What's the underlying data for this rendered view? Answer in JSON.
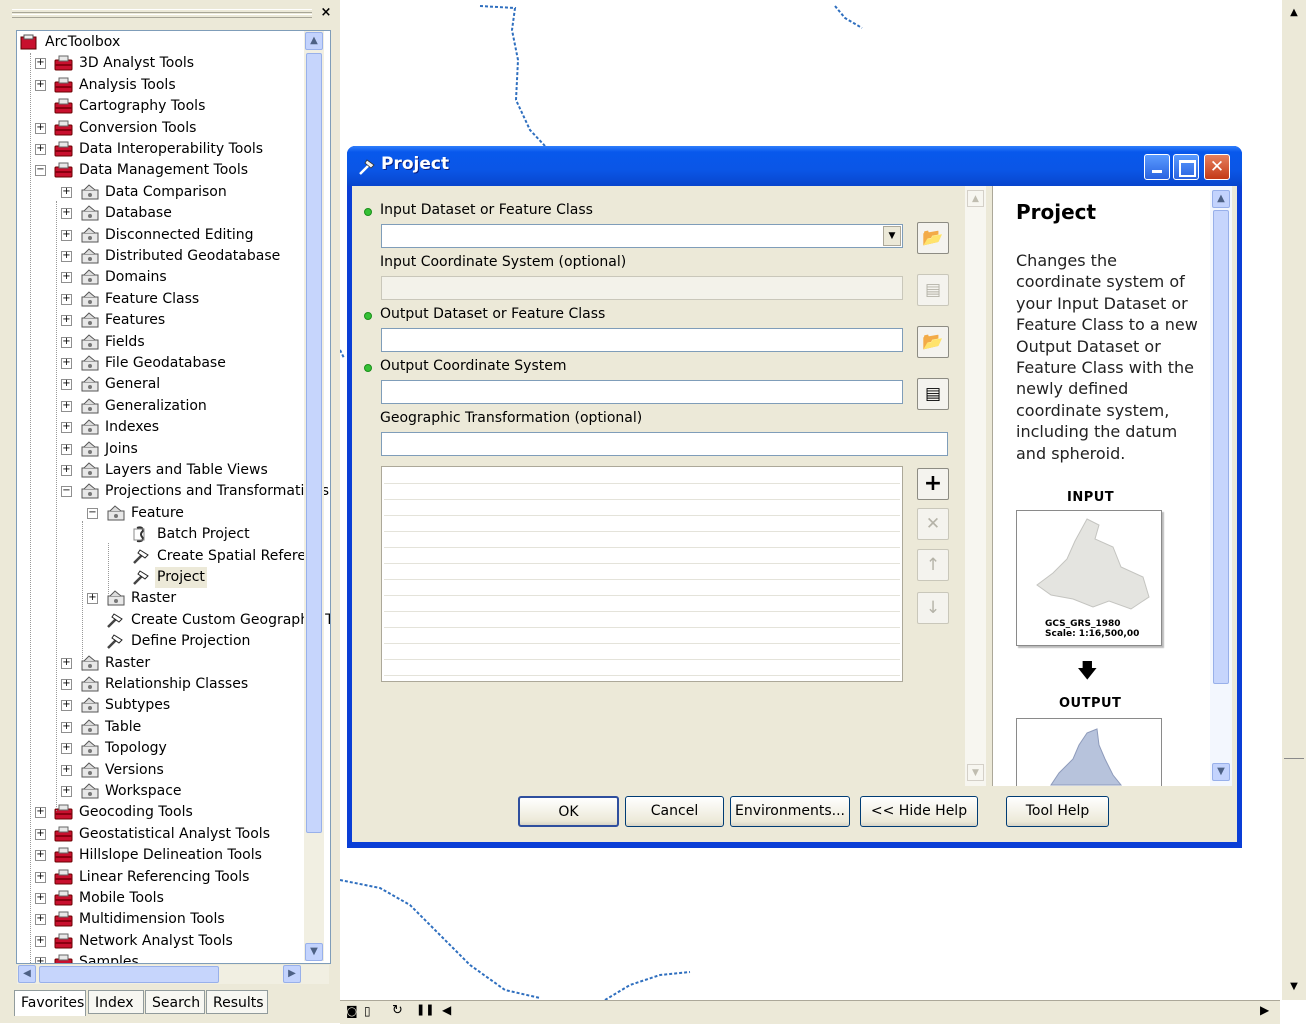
{
  "toolbox": {
    "close_label": "×",
    "tree": [
      {
        "label": "ArcToolbox",
        "level": 0,
        "expander": "",
        "icon": "arctoolbox-icon"
      },
      {
        "label": "3D Analyst Tools",
        "level": 1,
        "expander": "+",
        "icon": "toolbox-icon"
      },
      {
        "label": "Analysis Tools",
        "level": 1,
        "expander": "+",
        "icon": "toolbox-icon"
      },
      {
        "label": "Cartography Tools",
        "level": 1,
        "expander": "",
        "icon": "toolbox-icon"
      },
      {
        "label": "Conversion Tools",
        "level": 1,
        "expander": "+",
        "icon": "toolbox-icon"
      },
      {
        "label": "Data Interoperability Tools",
        "level": 1,
        "expander": "+",
        "icon": "toolbox-icon"
      },
      {
        "label": "Data Management Tools",
        "level": 1,
        "expander": "-",
        "icon": "toolbox-icon"
      },
      {
        "label": "Data Comparison",
        "level": 2,
        "expander": "+",
        "icon": "toolset-icon"
      },
      {
        "label": "Database",
        "level": 2,
        "expander": "+",
        "icon": "toolset-icon"
      },
      {
        "label": "Disconnected Editing",
        "level": 2,
        "expander": "+",
        "icon": "toolset-icon"
      },
      {
        "label": "Distributed Geodatabase",
        "level": 2,
        "expander": "+",
        "icon": "toolset-icon"
      },
      {
        "label": "Domains",
        "level": 2,
        "expander": "+",
        "icon": "toolset-icon"
      },
      {
        "label": "Feature Class",
        "level": 2,
        "expander": "+",
        "icon": "toolset-icon"
      },
      {
        "label": "Features",
        "level": 2,
        "expander": "+",
        "icon": "toolset-icon"
      },
      {
        "label": "Fields",
        "level": 2,
        "expander": "+",
        "icon": "toolset-icon"
      },
      {
        "label": "File Geodatabase",
        "level": 2,
        "expander": "+",
        "icon": "toolset-icon"
      },
      {
        "label": "General",
        "level": 2,
        "expander": "+",
        "icon": "toolset-icon"
      },
      {
        "label": "Generalization",
        "level": 2,
        "expander": "+",
        "icon": "toolset-icon"
      },
      {
        "label": "Indexes",
        "level": 2,
        "expander": "+",
        "icon": "toolset-icon"
      },
      {
        "label": "Joins",
        "level": 2,
        "expander": "+",
        "icon": "toolset-icon"
      },
      {
        "label": "Layers and Table Views",
        "level": 2,
        "expander": "+",
        "icon": "toolset-icon"
      },
      {
        "label": "Projections and Transformations",
        "level": 2,
        "expander": "-",
        "icon": "toolset-icon"
      },
      {
        "label": "Feature",
        "level": 3,
        "expander": "-",
        "icon": "toolset-icon"
      },
      {
        "label": "Batch Project",
        "level": 4,
        "expander": "",
        "icon": "script-icon"
      },
      {
        "label": "Create Spatial Referenc",
        "level": 4,
        "expander": "",
        "icon": "hammer-icon"
      },
      {
        "label": "Project",
        "level": 4,
        "expander": "",
        "icon": "hammer-icon",
        "selected": true
      },
      {
        "label": "Raster",
        "level": 3,
        "expander": "+",
        "icon": "toolset-icon"
      },
      {
        "label": "Create Custom Geographic T",
        "level": 3,
        "expander": "",
        "icon": "hammer-icon"
      },
      {
        "label": "Define Projection",
        "level": 3,
        "expander": "",
        "icon": "hammer-icon"
      },
      {
        "label": "Raster",
        "level": 2,
        "expander": "+",
        "icon": "toolset-icon"
      },
      {
        "label": "Relationship Classes",
        "level": 2,
        "expander": "+",
        "icon": "toolset-icon"
      },
      {
        "label": "Subtypes",
        "level": 2,
        "expander": "+",
        "icon": "toolset-icon"
      },
      {
        "label": "Table",
        "level": 2,
        "expander": "+",
        "icon": "toolset-icon"
      },
      {
        "label": "Topology",
        "level": 2,
        "expander": "+",
        "icon": "toolset-icon"
      },
      {
        "label": "Versions",
        "level": 2,
        "expander": "+",
        "icon": "toolset-icon"
      },
      {
        "label": "Workspace",
        "level": 2,
        "expander": "+",
        "icon": "toolset-icon"
      },
      {
        "label": "Geocoding Tools",
        "level": 1,
        "expander": "+",
        "icon": "toolbox-icon"
      },
      {
        "label": "Geostatistical Analyst Tools",
        "level": 1,
        "expander": "+",
        "icon": "toolbox-icon"
      },
      {
        "label": "Hillslope Delineation Tools",
        "level": 1,
        "expander": "+",
        "icon": "toolbox-icon"
      },
      {
        "label": "Linear Referencing Tools",
        "level": 1,
        "expander": "+",
        "icon": "toolbox-icon"
      },
      {
        "label": "Mobile Tools",
        "level": 1,
        "expander": "+",
        "icon": "toolbox-icon"
      },
      {
        "label": "Multidimension Tools",
        "level": 1,
        "expander": "+",
        "icon": "toolbox-icon"
      },
      {
        "label": "Network Analyst Tools",
        "level": 1,
        "expander": "+",
        "icon": "toolbox-icon"
      },
      {
        "label": "Samples",
        "level": 1,
        "expander": "+",
        "icon": "toolbox-icon"
      }
    ],
    "tabs": [
      "Favorites",
      "Index",
      "Search",
      "Results"
    ],
    "active_tab": "Favorites"
  },
  "dialog": {
    "title": "Project",
    "title_icon": "hammer-icon",
    "params": {
      "input_dataset_label": "Input Dataset or Feature Class",
      "input_dataset_value": "",
      "input_cs_label": "Input Coordinate System (optional)",
      "input_cs_value": "",
      "output_dataset_label": "Output Dataset or Feature Class",
      "output_dataset_value": "",
      "output_cs_label": "Output Coordinate System",
      "output_cs_value": "",
      "geo_transform_label": "Geographic Transformation (optional)",
      "geo_transform_value": "",
      "list_buttons": {
        "add": "+",
        "remove": "✕",
        "up": "↑",
        "down": "↓"
      }
    },
    "help": {
      "title": "Project",
      "description": "Changes the coordinate system of your Input Dataset or Feature Class to a new Output Dataset or Feature Class with the newly defined coordinate system, including the datum and spheroid.",
      "input_label": "INPUT",
      "input_map_caption_1": "GCS_GRS_1980",
      "input_map_caption_2": "Scale: 1:16,500,00",
      "arrow": "🡇",
      "output_label": "OUTPUT"
    },
    "buttons": {
      "ok": "OK",
      "cancel": "Cancel",
      "environments": "Environments...",
      "hide_help": "<< Hide Help",
      "tool_help": "Tool Help"
    }
  },
  "colors": {
    "xp_title_blue": "#0a56e6",
    "panel_beige": "#ece9d8",
    "required_dot_green": "#35c135"
  }
}
